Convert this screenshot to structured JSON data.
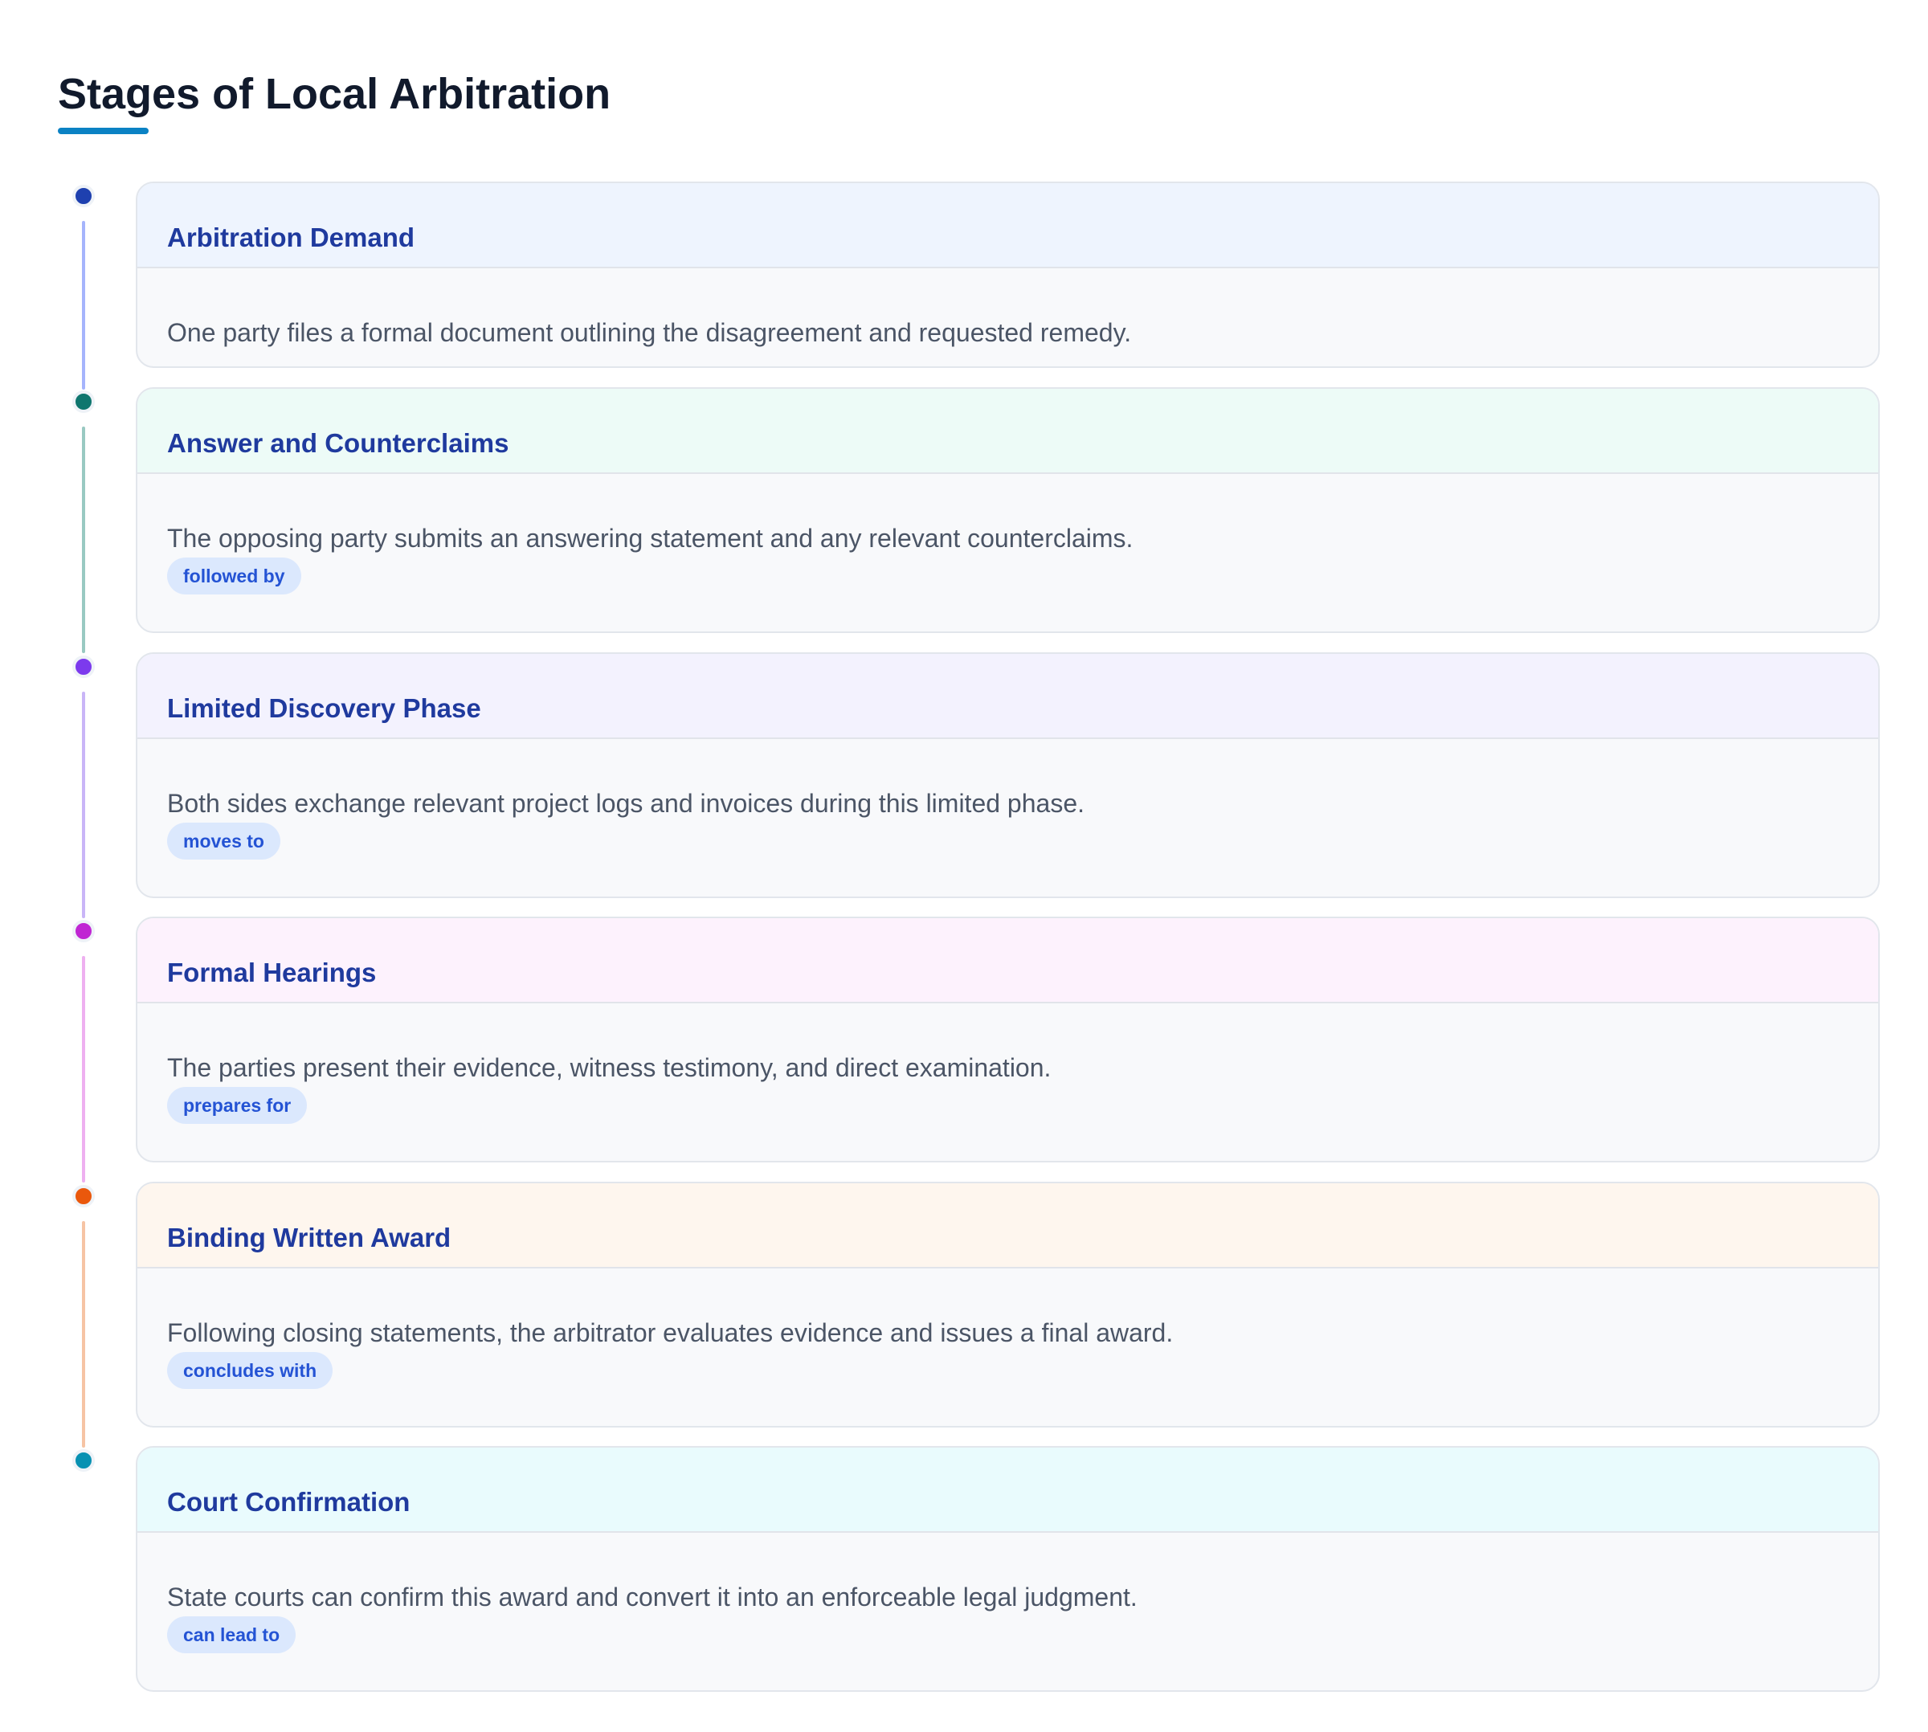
{
  "title": "Stages of Local Arbitration",
  "colors": {
    "title_underline": "#0b82c4",
    "card_title": "#1f3a9e",
    "badge_bg": "#dbe8fd",
    "badge_text": "#2453d4"
  },
  "stages": [
    {
      "title": "Arbitration Demand",
      "description": "One party files a formal document outlining the disagreement and requested remedy.",
      "badge": "",
      "dot_color": "#1e40af",
      "line_color": "#a5b4fc",
      "header_bg": "#eef4fe"
    },
    {
      "title": "Answer and Counterclaims",
      "description": "The opposing party submits an answering statement and any relevant counterclaims.",
      "badge": "followed by",
      "dot_color": "#0f766e",
      "line_color": "#99c9c2",
      "header_bg": "#edfbf7"
    },
    {
      "title": "Limited Discovery Phase",
      "description": "Both sides exchange relevant project logs and invoices during this limited phase.",
      "badge": "moves to",
      "dot_color": "#7c3aed",
      "line_color": "#c9b5f7",
      "header_bg": "#f3f2fe"
    },
    {
      "title": "Formal Hearings",
      "description": "The parties present their evidence, witness testimony, and direct examination.",
      "badge": "prepares for",
      "dot_color": "#c026d3",
      "line_color": "#eeb0f0",
      "header_bg": "#fdf2fd"
    },
    {
      "title": "Binding Written Award",
      "description": "Following closing statements, the arbitrator evaluates evidence and issues a final award.",
      "badge": "concludes with",
      "dot_color": "#ea580c",
      "line_color": "#f6c4a4",
      "header_bg": "#fef6ee"
    },
    {
      "title": "Court Confirmation",
      "description": "State courts can confirm this award and convert it into an enforceable legal judgment.",
      "badge": "can lead to",
      "dot_color": "#0891b2",
      "line_color": "",
      "header_bg": "#e9fbfd"
    }
  ]
}
